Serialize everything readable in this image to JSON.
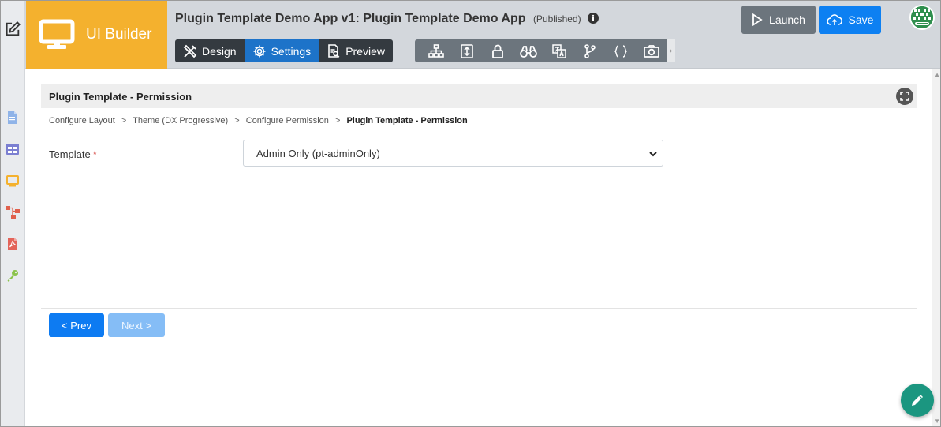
{
  "brand": {
    "label": "UI Builder"
  },
  "header": {
    "app_title": "Plugin Template Demo App v1: Plugin Template Demo App",
    "app_status": "(Published)"
  },
  "modes": [
    {
      "label": "Design",
      "icon": "design-tools-icon"
    },
    {
      "label": "Settings",
      "icon": "gear-icon",
      "active": true
    },
    {
      "label": "Preview",
      "icon": "preview-document-icon"
    }
  ],
  "tools": [
    "sitemap-icon",
    "import-export-icon",
    "lock-icon",
    "binoculars-icon",
    "translate-icon",
    "branch-icon",
    "curly-braces-icon",
    "camera-icon"
  ],
  "actions": {
    "launch_label": "Launch",
    "save_label": "Save"
  },
  "user": {
    "avatar": "admin-avatar"
  },
  "sidebar_icons": [
    "document-icon",
    "table-icon",
    "monitor-icon",
    "flow-icon",
    "pdf-icon",
    "key-icon"
  ],
  "panel": {
    "title": "Plugin Template - Permission"
  },
  "breadcrumb": {
    "items": [
      "Configure Layout",
      "Theme (DX Progressive)",
      "Configure Permission"
    ],
    "current": "Plugin Template - Permission",
    "separator": ">"
  },
  "form": {
    "template_label": "Template",
    "required_mark": "*",
    "template_value": "Admin Only (pt-adminOnly)"
  },
  "nav": {
    "prev_label": "< Prev",
    "next_label": "Next >"
  },
  "colors": {
    "brand": "#f4b12e",
    "primary": "#0d7bf2",
    "active_mode": "#1d73c9",
    "fab": "#1b9680",
    "header": "#d3d7dc"
  }
}
